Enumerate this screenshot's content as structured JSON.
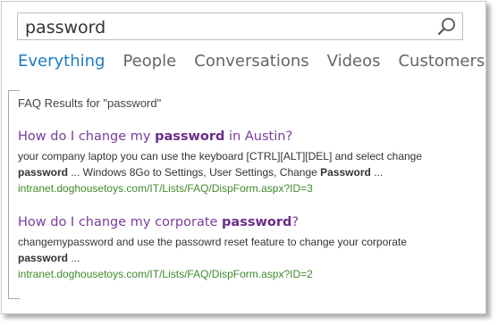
{
  "search": {
    "query": "password",
    "button_icon": "magnifier-icon"
  },
  "verticals": [
    {
      "label": "Everything",
      "active": true
    },
    {
      "label": "People",
      "active": false
    },
    {
      "label": "Conversations",
      "active": false
    },
    {
      "label": "Videos",
      "active": false
    },
    {
      "label": "Customers",
      "active": false
    }
  ],
  "faq": {
    "title": "FAQ Results for \"password\"",
    "results": [
      {
        "title_pre": "How do I change my ",
        "title_bold": "password",
        "title_post": " in Austin?",
        "body_line1": "your company laptop you can use the keyboard [CTRL][ALT][DEL] and select change",
        "body_b1": "password",
        "body_mid": " ... Windows 8Go to Settings, User Settings, Change ",
        "body_b2": "Password",
        "body_end": " ...",
        "url": "intranet.doghousetoys.com/IT/Lists/FAQ/DispForm.aspx?ID=3"
      },
      {
        "title_pre": "How do I change my corporate ",
        "title_bold": "password",
        "title_post": "?",
        "body_line1": "changemypassword and use the passowrd reset feature to change your corporate",
        "body_b1": "password",
        "body_end": " ...",
        "url": "intranet.doghousetoys.com/IT/Lists/FAQ/DispForm.aspx?ID=2"
      }
    ]
  },
  "colors": {
    "accent": "#1f7bc1",
    "result_title": "#7a3c9a",
    "url": "#3f8a2a"
  }
}
